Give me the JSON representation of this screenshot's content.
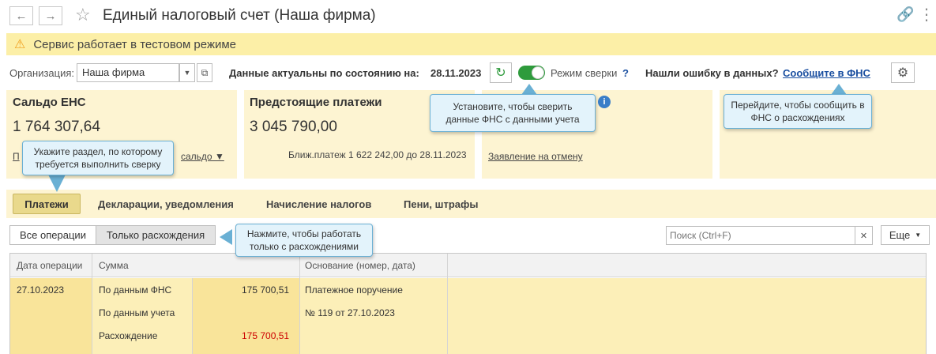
{
  "title": "Единый налоговый счет (Наша фирма)",
  "banner": "Сервис работает в тестовом режиме",
  "org": {
    "label": "Организация:",
    "value": "Наша фирма",
    "actual_label": "Данные актуальны по состоянию на:",
    "actual_date": "28.11.2023",
    "mode_label": "Режим сверки",
    "help": "?",
    "error_label": "Нашли ошибку в данных?",
    "error_link": "Сообщите в ФНС"
  },
  "cards": {
    "saldo_title": "Сальдо ЕНС",
    "saldo_amount": "1 764 307,64",
    "saldo_link_tail": "сальдо ▼",
    "upcoming_title": "Предстоящие платежи",
    "upcoming_amount": "3 045 790,00",
    "upcoming_next": "Ближ.платеж 1 622 242,00 до 28.11.2023",
    "cancel_link": "Заявление на отмену"
  },
  "tabs": [
    "Платежи",
    "Декларации, уведомления",
    "Начисление налогов",
    "Пени, штрафы"
  ],
  "filters": {
    "all": "Все операции",
    "diff": "Только расхождения",
    "search_placeholder": "Поиск (Ctrl+F)",
    "more": "Еще"
  },
  "table": {
    "headers": [
      "Дата операции",
      "Сумма",
      "Основание (номер, дата)"
    ],
    "date": "27.10.2023",
    "rows": [
      {
        "label": "По данным ФНС",
        "amount": "175 700,51",
        "basis": "Платежное поручение"
      },
      {
        "label": "По данным учета",
        "amount": "",
        "basis": "№ 119 от 27.10.2023"
      },
      {
        "label": "Расхождение",
        "amount": "175 700,51",
        "basis": ""
      }
    ]
  },
  "callouts": {
    "mode": "Установите, чтобы сверить данные ФНС с данными учета",
    "report": "Перейдите, чтобы сообщить в ФНС о расхождениях",
    "section": "Укажите раздел, по которому требуется выполнить сверку",
    "diff": "Нажмите, чтобы работать только с расхождениями"
  },
  "colors": {
    "banner": "#fcefa7",
    "card": "#fdf4d2",
    "accent_green": "#2e9b3c",
    "link": "#1a4fa0",
    "discrepancy": "#cc0000"
  }
}
